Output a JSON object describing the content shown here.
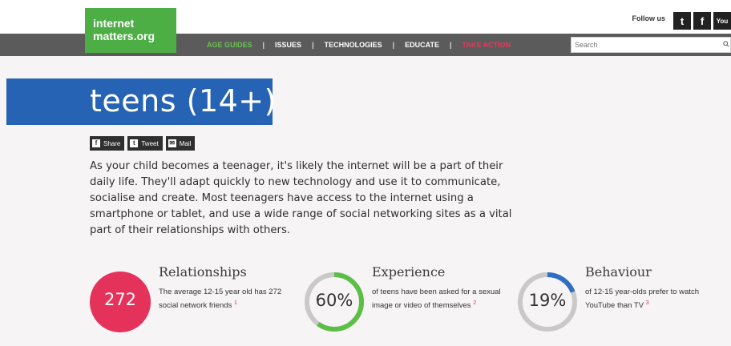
{
  "logo": {
    "line1": "internet",
    "line2": "matters.org"
  },
  "header": {
    "follow_label": "Follow us",
    "social": [
      {
        "icon": "twitter-icon",
        "glyph": "t"
      },
      {
        "icon": "facebook-icon",
        "glyph": "f"
      },
      {
        "icon": "youtube-icon",
        "glyph": "You"
      }
    ]
  },
  "nav": {
    "items": [
      {
        "label": "AGE GUIDES",
        "color": "#66c44f"
      },
      {
        "label": "ISSUES"
      },
      {
        "label": "TECHNOLOGIES"
      },
      {
        "label": "EDUCATE"
      },
      {
        "label": "TAKE ACTION",
        "color": "#e23a5c"
      }
    ],
    "separator": "|"
  },
  "search": {
    "placeholder": "Search"
  },
  "page": {
    "title": "teens (14+)",
    "share": {
      "share": "Share",
      "tweet": "Tweet",
      "mail": "Mail"
    },
    "intro": "As your child becomes a teenager, it's likely the internet will be a part of their daily life. They'll adapt quickly to new technology and use it to communicate, socialise and create. Most teenagers have access to the internet using a smartphone or tablet, and use a wide range of social networking sites as a vital part of their relationships with others."
  },
  "stats": [
    {
      "title": "Relationships",
      "value": "272",
      "desc": "The average 12-15 year old has 272 social network friends",
      "ref": "1",
      "color": "#e4325a"
    },
    {
      "title": "Experience",
      "value": "60%",
      "progress": 0.6,
      "desc": "of teens have been asked for a sexual image or video of themselves",
      "ref": "2",
      "color": "#5cbf45"
    },
    {
      "title": "Behaviour",
      "value": "19%",
      "progress": 0.19,
      "desc": "of 12-15 year-olds prefer to watch YouTube than TV",
      "ref": "3",
      "color": "#2f6fc2"
    }
  ]
}
